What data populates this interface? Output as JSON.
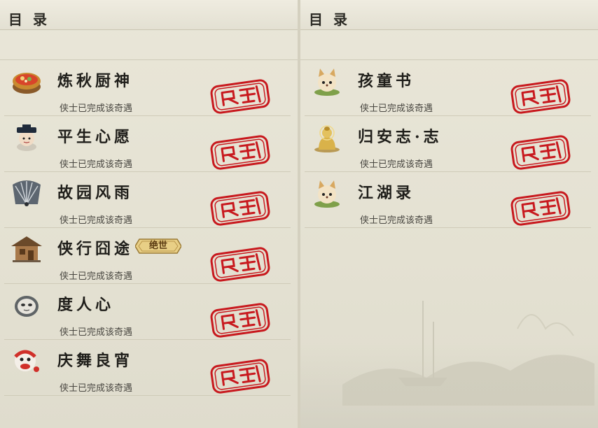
{
  "left_panel": {
    "title": "目 录",
    "entries": [
      {
        "name": "炼秋厨神",
        "status": "侠士已完成该奇遇",
        "icon": "food-pot-icon"
      },
      {
        "name": "平生心愿",
        "status": "侠士已完成该奇遇",
        "icon": "official-icon"
      },
      {
        "name": "故园风雨",
        "status": "侠士已完成该奇遇",
        "icon": "fan-icon"
      },
      {
        "name": "侠行囧途",
        "status": "侠士已完成该奇遇",
        "icon": "house-icon",
        "badge": "绝世"
      },
      {
        "name": "度人心",
        "status": "侠士已完成该奇遇",
        "icon": "mask-icon"
      },
      {
        "name": "庆舞良宵",
        "status": "侠士已完成该奇遇",
        "icon": "lion-dance-icon"
      }
    ]
  },
  "right_panel": {
    "title": "目 录",
    "entries": [
      {
        "name": "孩童书",
        "status": "侠士已完成该奇遇",
        "icon": "fox-icon"
      },
      {
        "name": "归安志·志",
        "status": "侠士已完成该奇遇",
        "icon": "buddha-icon"
      },
      {
        "name": "江湖录",
        "status": "侠士已完成该奇遇",
        "icon": "fox-icon"
      }
    ]
  },
  "colors": {
    "stamp_red": "#c8191e",
    "background": "#e6e3d5",
    "badge_gold": "#e8cf86"
  }
}
